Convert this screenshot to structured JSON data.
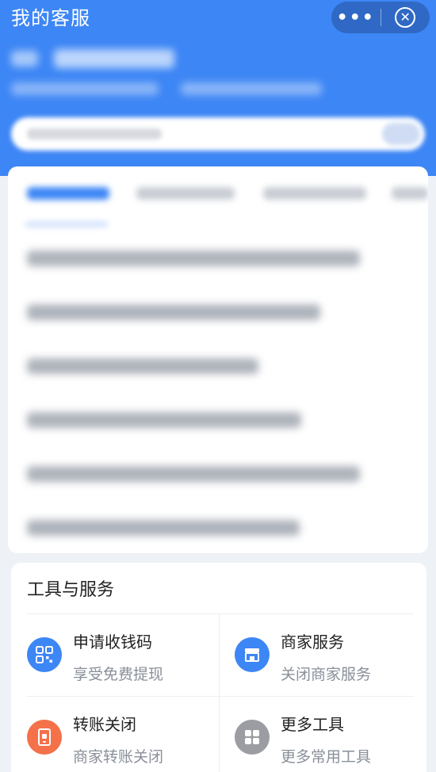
{
  "header": {
    "title": "我的客服",
    "more_label": "•••",
    "close_label": "✕",
    "background_color": "#3d86f5"
  },
  "tools": {
    "title": "工具与服务",
    "items": [
      {
        "label": "申请收钱码",
        "desc": "享受免费提现",
        "icon": "qr-code-icon",
        "color": "#3d86f5"
      },
      {
        "label": "商家服务",
        "desc": "关闭商家服务",
        "icon": "store-icon",
        "color": "#3d86f5"
      },
      {
        "label": "转账关闭",
        "desc": "商家转账关闭",
        "icon": "phone-transfer-icon",
        "color": "#f4714a"
      },
      {
        "label": "更多工具",
        "desc": "更多常用工具",
        "icon": "grid-icon",
        "color": "#9b9da3"
      }
    ]
  }
}
